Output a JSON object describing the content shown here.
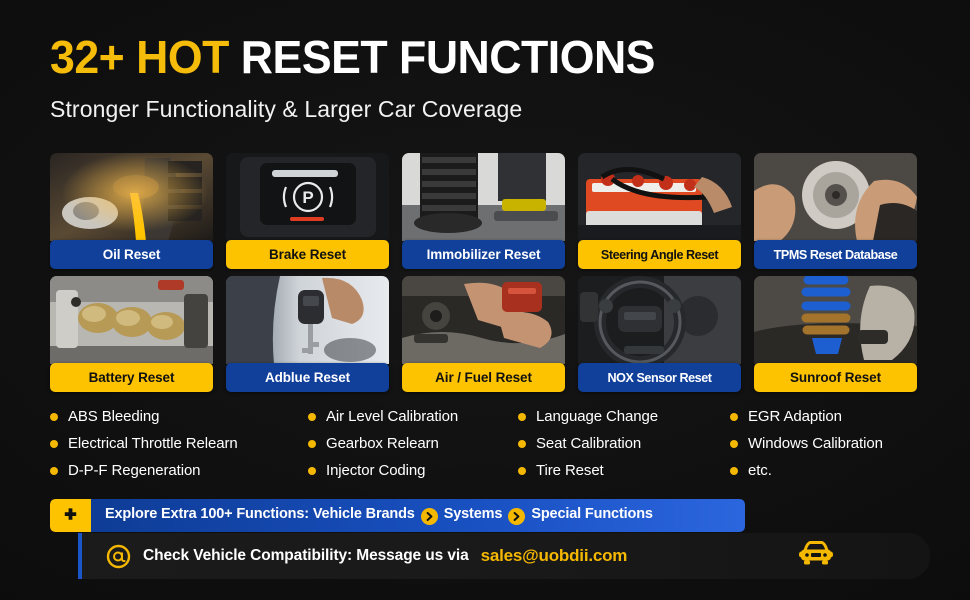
{
  "header": {
    "title_highlight": "32+ HOT",
    "title_rest": "RESET FUNCTIONS",
    "subtitle": "Stronger Functionality & Larger Car Coverage"
  },
  "colors": {
    "background": "#111111",
    "blue": "#11409B",
    "yellow": "#FDC300",
    "title_yellow": "#F5BC09",
    "text_white": "#FFFFFF",
    "bullet_dot": "#F5B800",
    "explore_blue_start": "#0E3C96",
    "explore_blue_end": "#2C66DE",
    "contact_border": "#1B56C8"
  },
  "cards": {
    "row1": [
      {
        "label": "Oil Reset",
        "style": "blue",
        "image": "engine-oil-pour"
      },
      {
        "label": "Brake Reset",
        "style": "yellow",
        "image": "parking-brake-button"
      },
      {
        "label": "Immobilizer Reset",
        "style": "blue",
        "image": "tire-wheel-service"
      },
      {
        "label": "Steering Angle Reset",
        "style": "yellow",
        "image": "car-battery-red"
      },
      {
        "label": "TPMS Reset Database",
        "style": "blue",
        "image": "brake-disc-hands"
      }
    ],
    "row2": [
      {
        "label": "Battery Reset",
        "style": "yellow",
        "image": "exhaust-manifold"
      },
      {
        "label": "Adblue Reset",
        "style": "blue",
        "image": "car-key-hand"
      },
      {
        "label": "Air / Fuel Reset",
        "style": "yellow",
        "image": "engine-bay-hands"
      },
      {
        "label": "NOX Sensor Reset",
        "style": "blue",
        "image": "steering-wheel-dash"
      },
      {
        "label": "Sunroof Reset",
        "style": "yellow",
        "image": "blue-coil-spring"
      }
    ]
  },
  "bullets": {
    "col1": [
      "ABS Bleeding",
      "Electrical Throttle Relearn",
      "D-P-F Regeneration"
    ],
    "col2": [
      "Air Level Calibration",
      "Gearbox Relearn",
      "Injector Coding"
    ],
    "col3": [
      "Language Change",
      "Seat Calibration",
      "Tire Reset"
    ],
    "col4": [
      "EGR Adaption",
      "Windows Calibration",
      "etc."
    ]
  },
  "explore_bar": {
    "badge_icon": "plus-icon",
    "text_part1": "Explore Extra 100+ Functions: Vehicle Brands",
    "text_part2": "Systems",
    "text_part3": "Special Functions",
    "arrow_icon": "chevron-right-circle-icon"
  },
  "contact_bar": {
    "at_icon": "at-sign-icon",
    "text": "Check Vehicle Compatibility: Message us via",
    "email": "sales@uobdii.com",
    "car_icon": "car-front-icon"
  }
}
